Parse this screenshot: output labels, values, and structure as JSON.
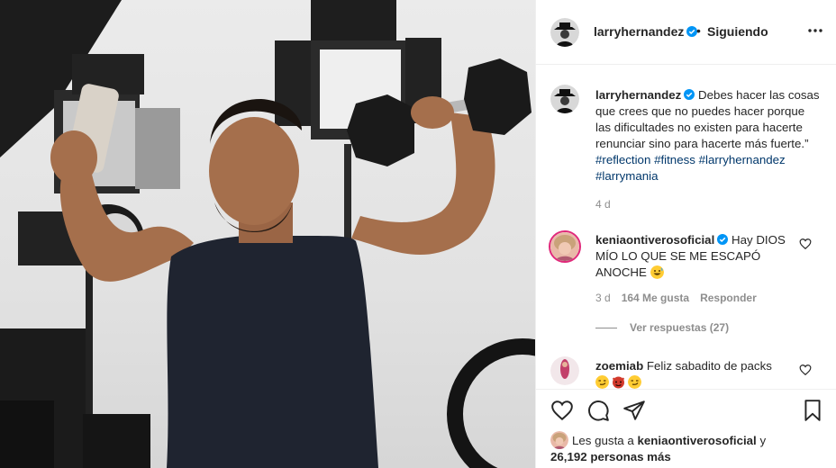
{
  "post": {
    "username": "larryhernandez",
    "separator": "•",
    "follow_status": "Siguiendo"
  },
  "caption": {
    "username": "larryhernandez",
    "text": "Debes hacer las cosas que crees que no puedes hacer porque las dificultades no existen para hacerte renunciar sino para hacerte más fuerte.”",
    "hashtags": [
      "#reflection",
      "#fitness",
      "#larryhernandez",
      "#larrymania"
    ],
    "time": "4 d"
  },
  "comments": [
    {
      "username": "keniaontiverosoficial",
      "text": "Hay DIOS MÍO LO QUE SE ME ESCAPÓ ANOCHE",
      "time": "3 d",
      "likes": "164 Me gusta",
      "reply": "Responder",
      "view_replies": "Ver respuestas (27)",
      "emoji": "grinning-sweat-emoji"
    },
    {
      "username": "zoemiab",
      "text": "Feliz sabadito de packs",
      "emojis": [
        "smirk-emoji",
        "devil-emoji",
        "smirk-emoji"
      ]
    }
  ],
  "likes_line": {
    "prefix": "Les gusta a",
    "user": "keniaontiverosoficial",
    "connector": "y",
    "count": "26,192 personas más"
  },
  "icons": [
    "verified-badge-icon",
    "more-options-icon",
    "like-icon",
    "comment-icon",
    "share-icon",
    "save-icon"
  ],
  "colors": {
    "link": "#00376b",
    "verified": "#0095f6",
    "meta_grey": "#8e8e8e",
    "border": "#efefef"
  }
}
